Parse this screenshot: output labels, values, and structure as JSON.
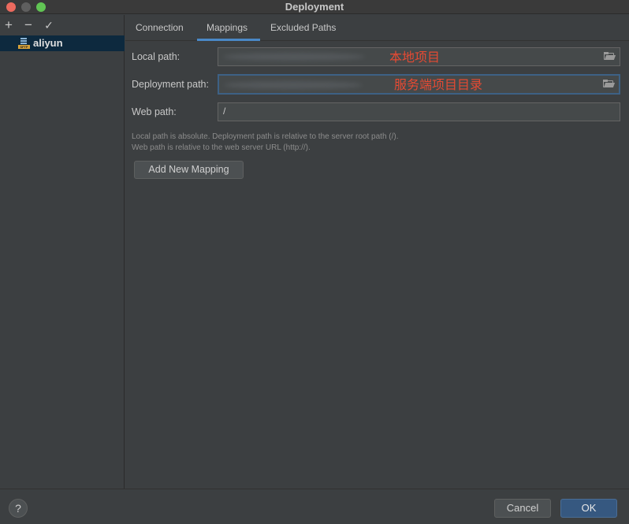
{
  "window": {
    "title": "Deployment"
  },
  "sidebar": {
    "tools": {
      "add": "+",
      "remove": "−",
      "apply": "✓"
    },
    "servers": [
      {
        "label": "aliyun",
        "icon": "sftp-server-icon",
        "icon_tag": "SFTP"
      }
    ]
  },
  "tabs": [
    {
      "label": "Connection"
    },
    {
      "label": "Mappings",
      "active": true
    },
    {
      "label": "Excluded Paths"
    }
  ],
  "mappings": {
    "local_path": {
      "label": "Local path:",
      "value": "",
      "annotation": "本地项目"
    },
    "deployment_path": {
      "label": "Deployment path:",
      "value": "",
      "annotation": "服务端项目目录"
    },
    "web_path": {
      "label": "Web path:",
      "value": "/"
    },
    "hint_line1": "Local path is absolute. Deployment path is relative to the server root path (/).",
    "hint_line2": "Web path is relative to the web server URL (http://).",
    "add_mapping_label": "Add New Mapping"
  },
  "footer": {
    "help_label": "?",
    "cancel_label": "Cancel",
    "ok_label": "OK"
  },
  "colors": {
    "accent": "#4a88c7",
    "ok_button": "#365880",
    "annotation": "#e64a33",
    "selection": "#0d293e"
  }
}
